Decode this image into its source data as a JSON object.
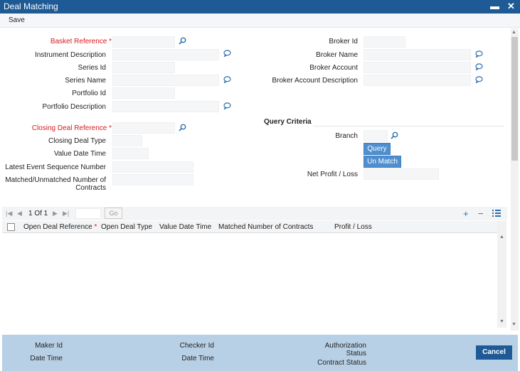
{
  "window": {
    "title": "Deal Matching",
    "minimize_glyph": "▬",
    "close_glyph": "✕"
  },
  "toolbar": {
    "save_label": "Save"
  },
  "form_left": {
    "basket_reference": "Basket Reference *",
    "instrument_description": "Instrument Description",
    "series_id": "Series Id",
    "series_name": "Series Name",
    "portfolio_id": "Portfolio Id",
    "portfolio_description": "Portfolio Description",
    "closing_deal_reference": "Closing Deal Reference *",
    "closing_deal_type": "Closing Deal Type",
    "value_date_time": "Value Date Time",
    "latest_event_sequence_number": "Latest Event Sequence Number",
    "matched_unmatched_line1": "Matched/Unmatched Number of",
    "matched_unmatched_line2": "Contracts"
  },
  "form_right": {
    "broker_id": "Broker Id",
    "broker_name": "Broker Name",
    "broker_account": "Broker Account",
    "broker_account_description": "Broker Account Description"
  },
  "query_criteria": {
    "heading": "Query Criteria",
    "branch": "Branch",
    "query_button": "Query",
    "unmatch_button": "Un Match",
    "net_profit_loss": "Net Profit / Loss"
  },
  "grid": {
    "pagination": "1 Of 1",
    "go_label": "Go",
    "columns": [
      "Open Deal Reference",
      "Open Deal Type",
      "Value Date Time",
      "Matched Number of Contracts",
      "Profit / Loss"
    ],
    "required_marker": "*"
  },
  "footer": {
    "maker_id": "Maker Id",
    "date_time": "Date Time",
    "checker_id": "Checker Id",
    "checker_date_time": "Date Time",
    "authorization_line1": "Authorization",
    "authorization_line2": "Status",
    "contract_status": "Contract Status",
    "cancel_label": "Cancel"
  },
  "icons": {
    "search": "search-icon",
    "lookup": "speech-bubble-icon"
  },
  "colors": {
    "title_bar": "#1e5a96",
    "required": "#d9191f",
    "button": "#4f8fcf",
    "footer": "#b8d0e5"
  }
}
